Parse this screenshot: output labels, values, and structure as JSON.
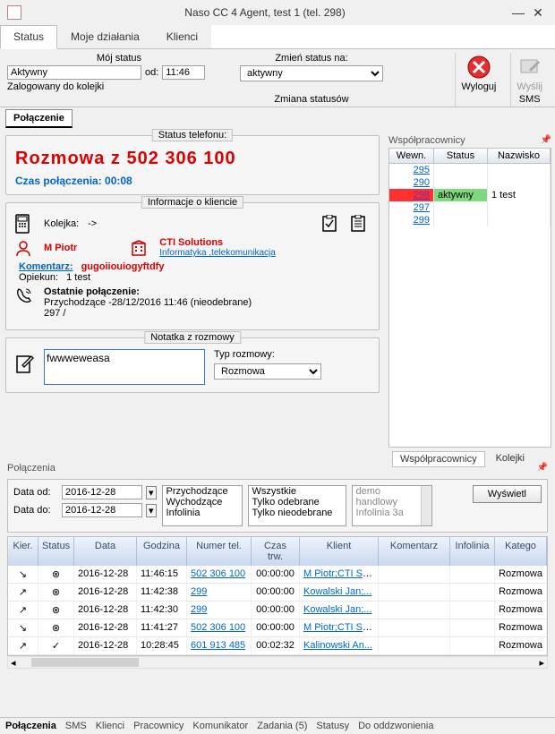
{
  "window": {
    "title": "Naso CC 4 Agent, test 1 (tel. 298)"
  },
  "main_tabs": {
    "status": "Status",
    "actions": "Moje działania",
    "clients": "Klienci"
  },
  "status_area": {
    "my_status_label": "Mój status",
    "my_status_value": "Aktywny",
    "od_label": "od:",
    "od_value": "11:46",
    "logged_queue": "Zalogowany do kolejki",
    "change_to_label": "Zmień status na:",
    "change_to_value": "aktywny",
    "change_history": "Zmiana statusów",
    "logout": "Wyloguj",
    "send": "Wyślij",
    "sms": "SMS"
  },
  "connection_tab": "Połączenie",
  "phone_status": {
    "group": "Status telefonu:",
    "line": "Rozmowa z 502 306 100",
    "time_label": "Czas połączenia: 00:08"
  },
  "client_info": {
    "group": "Informacje o kliencie",
    "queue_label": "Kolejka:",
    "queue_value": "->",
    "name": "M Piotr",
    "company": "CTI Solutions",
    "industry": "Informatyka ,telekomunikacja",
    "comment_label": "Komentarz:",
    "comment_value": "gugoiiouiogyftdfy",
    "keeper_label": "Opiekun:",
    "keeper_value": "1 test",
    "last_call_label": "Ostatnie połączenie:",
    "last_call_value1": "Przychodzące -28/12/2016 11:46 (nieodebrane)",
    "last_call_value2": "297 /"
  },
  "note": {
    "group": "Notatka z rozmowy",
    "value": "fwwweweasa",
    "type_label": "Typ rozmowy:",
    "type_value": "Rozmowa"
  },
  "coworkers": {
    "header": "Współpracownicy",
    "cols": {
      "ext": "Wewn.",
      "status": "Status",
      "name": "Nazwisko"
    },
    "rows": [
      {
        "ext": "295",
        "status": "",
        "name": ""
      },
      {
        "ext": "290",
        "status": "",
        "name": ""
      },
      {
        "ext": "298",
        "status": "aktywny",
        "name": "1 test",
        "hl": true
      },
      {
        "ext": "297",
        "status": "",
        "name": ""
      },
      {
        "ext": "299",
        "status": "",
        "name": ""
      }
    ],
    "tabs": {
      "cowork": "Współpracownicy",
      "queues": "Kolejki"
    }
  },
  "connections": {
    "header": "Połączenia",
    "date_from_label": "Data od:",
    "date_to_label": "Data do:",
    "date_from": "2016-12-28",
    "date_to": "2016-12-28",
    "dir_options": [
      "Przychodzące",
      "Wychodzące",
      "Infolinia"
    ],
    "pick_options": [
      "Wszystkie",
      "Tylko odebrane",
      "Tylko nieodebrane"
    ],
    "queue_options": [
      "demo",
      "handlowy",
      "Infolinia 3a"
    ],
    "show_btn": "Wyświetl",
    "cols": {
      "kier": "Kier.",
      "status": "Status",
      "data": "Data",
      "godz": "Godzina",
      "num": "Numer tel.",
      "czas": "Czas trw.",
      "kli": "Klient",
      "kom": "Komentarz",
      "inf": "Infolinia",
      "kat": "Katego"
    },
    "rows": [
      {
        "kier": "↘",
        "status": "⊗",
        "data": "2016-12-28",
        "godz": "11:46:15",
        "num": "502 306 100",
        "czas": "00:00:00",
        "kli": "M Piotr;CTI Sol...",
        "kom": "",
        "inf": "",
        "kat": "Rozmowa"
      },
      {
        "kier": "↗",
        "status": "⊗",
        "data": "2016-12-28",
        "godz": "11:42:38",
        "num": "299",
        "czas": "00:00:00",
        "kli": "Kowalski Jan;...",
        "kom": "",
        "inf": "",
        "kat": "Rozmowa"
      },
      {
        "kier": "↗",
        "status": "⊗",
        "data": "2016-12-28",
        "godz": "11:42:30",
        "num": "299",
        "czas": "00:00:00",
        "kli": "Kowalski Jan;...",
        "kom": "",
        "inf": "",
        "kat": "Rozmowa"
      },
      {
        "kier": "↘",
        "status": "⊗",
        "data": "2016-12-28",
        "godz": "11:41:27",
        "num": "502 306 100",
        "czas": "00:00:00",
        "kli": "M Piotr;CTI Sol...",
        "kom": "",
        "inf": "",
        "kat": "Rozmowa"
      },
      {
        "kier": "↗",
        "status": "✓",
        "data": "2016-12-28",
        "godz": "10:28:45",
        "num": "601 913 485",
        "czas": "00:02:32",
        "kli": "Kalinowski An...",
        "kom": "",
        "inf": "",
        "kat": "Rozmowa"
      }
    ]
  },
  "bottom_tabs": {
    "polaczenia": "Połączenia",
    "sms": "SMS",
    "klienci": "Klienci",
    "pracownicy": "Pracownicy",
    "komunikator": "Komunikator",
    "zadania": "Zadania (5)",
    "statusy": "Statusy",
    "dooddz": "Do oddzwonienia"
  }
}
